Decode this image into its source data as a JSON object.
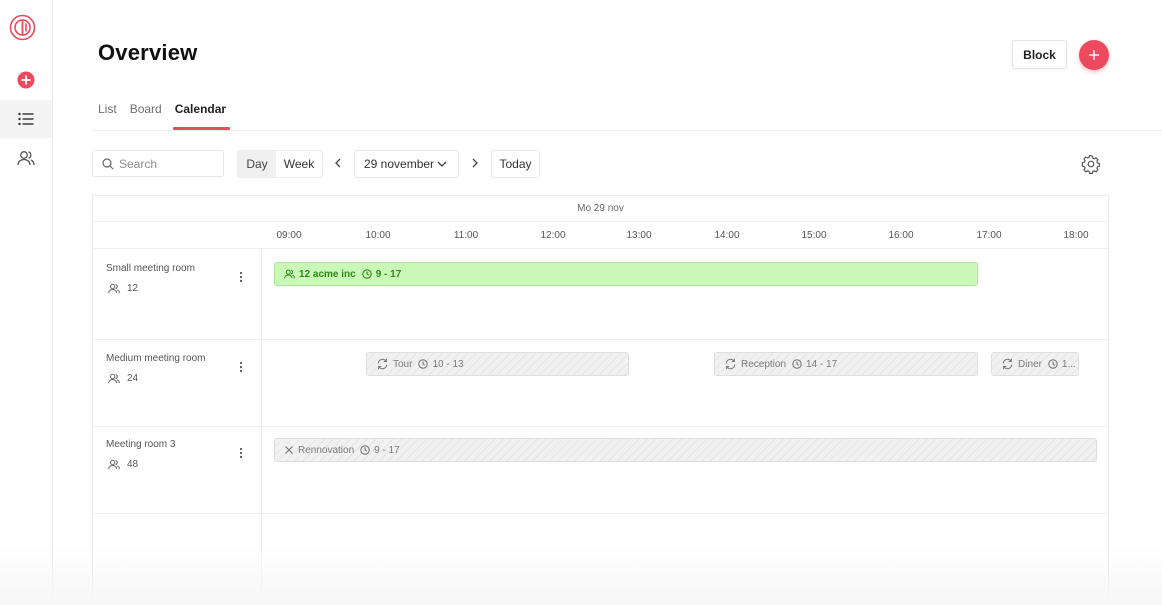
{
  "colors": {
    "accent": "#ee4a5f",
    "booking_bg": "#c9f8b8",
    "booking_text": "#2f8a17"
  },
  "sidebar": {
    "items": [
      {
        "icon": "plus-circle-icon"
      },
      {
        "icon": "list-icon"
      },
      {
        "icon": "users-icon"
      }
    ]
  },
  "header": {
    "title": "Overview",
    "block_label": "Block"
  },
  "tabs": [
    {
      "label": "List"
    },
    {
      "label": "Board"
    },
    {
      "label": "Calendar",
      "active": true
    }
  ],
  "toolbar": {
    "search_placeholder": "Search",
    "view_day": "Day",
    "view_week": "Week",
    "date_value": "29 november",
    "today_label": "Today"
  },
  "calendar": {
    "date_header": "Mo 29 nov",
    "times": [
      "09:00",
      "10:00",
      "11:00",
      "12:00",
      "13:00",
      "14:00",
      "15:00",
      "16:00",
      "17:00",
      "18:00"
    ],
    "rooms": [
      {
        "name": "Small meeting room",
        "capacity": "12"
      },
      {
        "name": "Medium meeting room",
        "capacity": "24"
      },
      {
        "name": "Meeting room 3",
        "capacity": "48"
      }
    ],
    "events": [
      {
        "room": 0,
        "type": "booking",
        "icon": "users-icon",
        "title": "12 acme inc",
        "time": "9 - 17"
      },
      {
        "room": 1,
        "type": "block",
        "icon": "refresh-icon",
        "title": "Tour",
        "time": "10 - 13"
      },
      {
        "room": 1,
        "type": "block",
        "icon": "refresh-icon",
        "title": "Reception",
        "time": "14 - 17"
      },
      {
        "room": 1,
        "type": "block",
        "icon": "refresh-icon",
        "title": "Diner",
        "time": "1..."
      },
      {
        "room": 2,
        "type": "block",
        "icon": "close-icon",
        "title": "Rennovation",
        "time": "9 - 17"
      }
    ]
  }
}
